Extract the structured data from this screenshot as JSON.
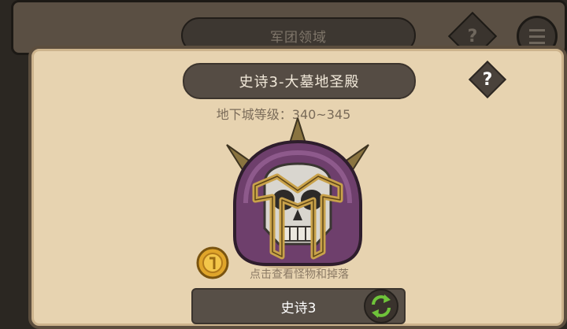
{
  "background": {
    "title": "军团领域",
    "help_icon": "question-icon",
    "menu_icon": "menu-icon"
  },
  "dungeon": {
    "title": "史诗3-大墓地圣殿",
    "level_label": "地下城等级：",
    "level_range": "340~345",
    "boss_icon": "helmeted-skull-icon",
    "hint": "点击查看怪物和掉落",
    "difficulty_label": "史诗3",
    "swap_icon": "swap-arrows-icon"
  },
  "colors": {
    "parchment": "#e7d3b0",
    "banner": "#554c44",
    "helmet_purple": "#6e3f6c",
    "helmet_gold": "#c9a24a",
    "swap_green": "#6fc43a"
  }
}
